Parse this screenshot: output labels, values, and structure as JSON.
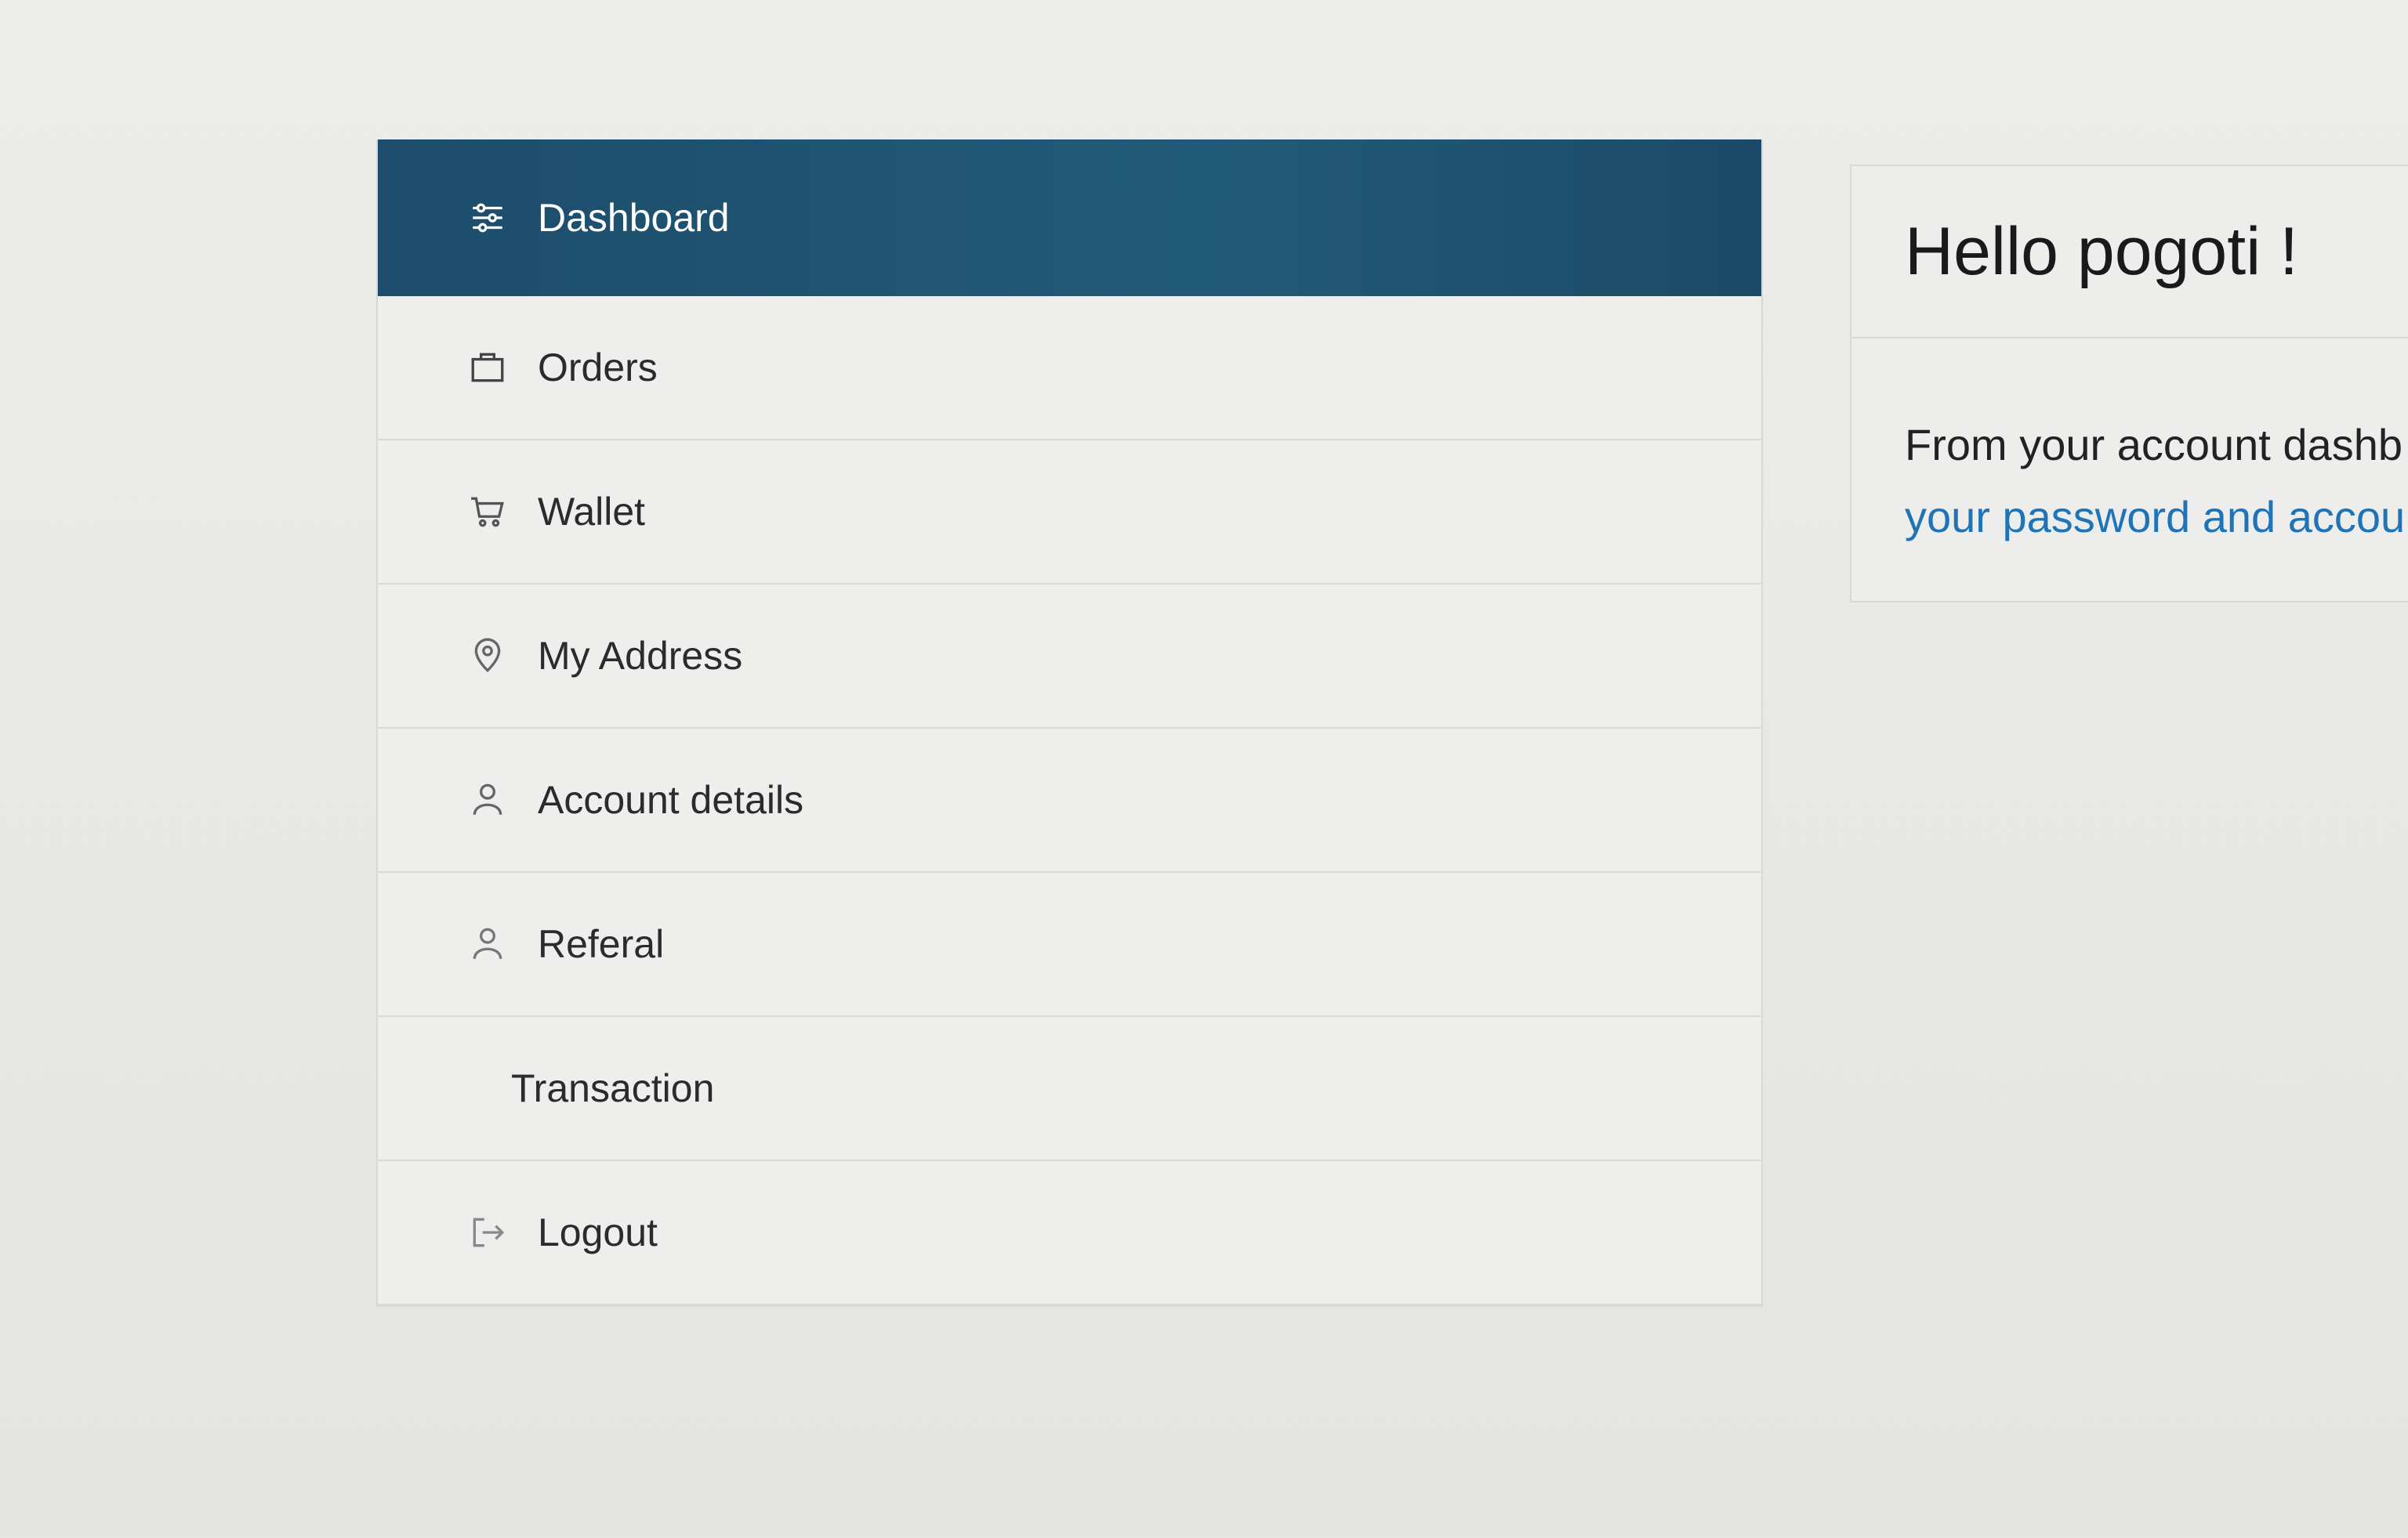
{
  "sidebar": {
    "items": [
      {
        "label": "Dashboard",
        "icon": "sliders-icon",
        "active": true
      },
      {
        "label": "Orders",
        "icon": "shopping-bag-icon"
      },
      {
        "label": "Wallet",
        "icon": "cart-icon"
      },
      {
        "label": "My Address",
        "icon": "map-pin-icon"
      },
      {
        "label": "Account details",
        "icon": "user-icon"
      },
      {
        "label": "Referal",
        "icon": "user-icon"
      },
      {
        "label": "Transaction",
        "icon": ""
      },
      {
        "label": "Logout",
        "icon": "logout-icon"
      }
    ]
  },
  "main": {
    "greeting": "Hello pogoti !",
    "intro_text": "From your account dashb",
    "link_text": "your password and accou"
  },
  "colors": {
    "active_bg": "#1d4c6c",
    "link": "#1f73b7"
  }
}
